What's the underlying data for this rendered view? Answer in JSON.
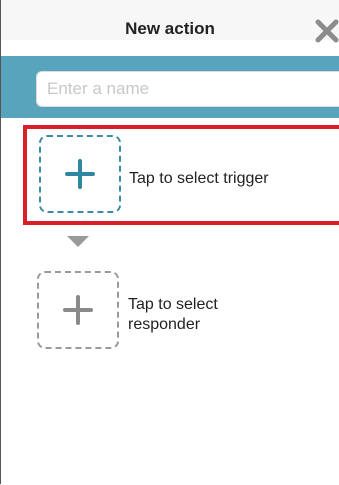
{
  "header": {
    "title": "New action",
    "close_icon": "close-icon"
  },
  "name_field": {
    "placeholder": "Enter a name",
    "value": ""
  },
  "trigger": {
    "label": "Tap to select trigger",
    "icon": "plus-icon"
  },
  "responder": {
    "label": "Tap to select responder",
    "icon": "plus-icon"
  },
  "colors": {
    "accent": "#57a4bc",
    "trigger_plus": "#2f86a2",
    "highlight": "#d91f2a",
    "inactive": "#9a9a9a"
  }
}
